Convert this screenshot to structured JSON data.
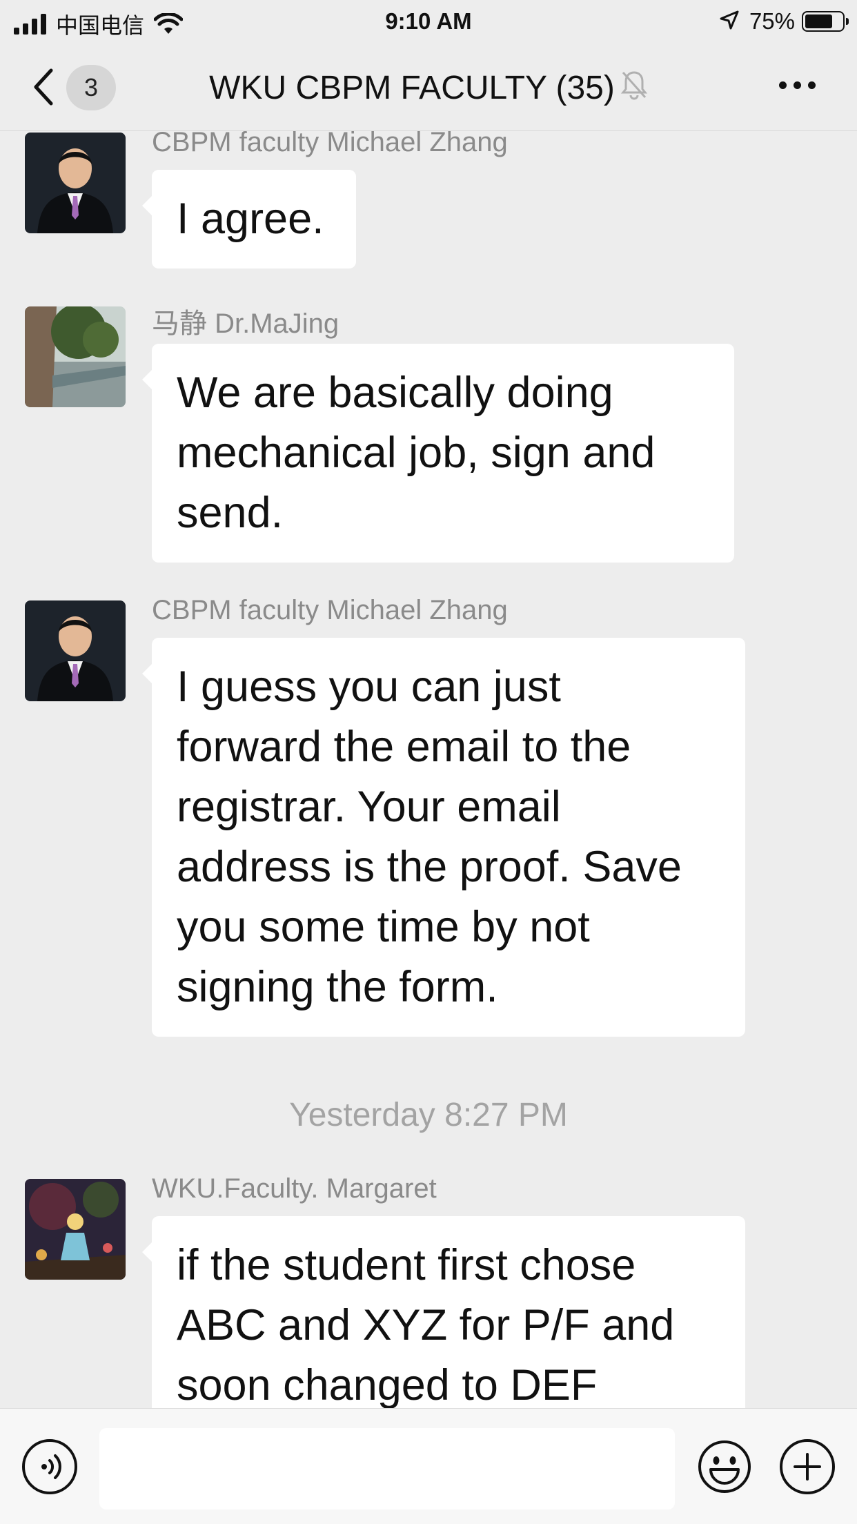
{
  "status_bar": {
    "carrier": "中国电信",
    "time": "9:10 AM",
    "battery_percent": "75%",
    "battery_level": 0.75
  },
  "nav": {
    "back_icon": "chevron-left-icon",
    "unread_count": "3",
    "title": "WKU CBPM FACULTY (35)",
    "muted_icon": "bell-muted-icon",
    "more_icon": "more-dots-icon"
  },
  "messages": [
    {
      "sender": "CBPM faculty Michael Zhang",
      "avatar": "person-in-suit",
      "lines": [
        "I agree."
      ]
    },
    {
      "sender": "马静 Dr.MaJing",
      "avatar": "landscape-photo",
      "lines": [
        "We are basically doing",
        "mechanical job, sign and",
        "send."
      ]
    },
    {
      "sender": "CBPM faculty Michael Zhang",
      "avatar": "person-in-suit",
      "lines": [
        "I guess you can just",
        "forward the email to the",
        "registrar. Your email",
        "address is the proof. Save",
        "you some time by not",
        "signing the form."
      ]
    },
    {
      "sender": "WKU.Faculty. Margaret",
      "avatar": "illustration",
      "lines": [
        "if the student first chose",
        "ABC and XYZ for P/F and",
        "soon changed to DEF"
      ]
    }
  ],
  "timestamp": "Yesterday 8:27 PM",
  "input_bar": {
    "voice_icon": "voice-icon",
    "input_value": "",
    "emoji_icon": "emoji-icon",
    "plus_icon": "plus-icon"
  }
}
